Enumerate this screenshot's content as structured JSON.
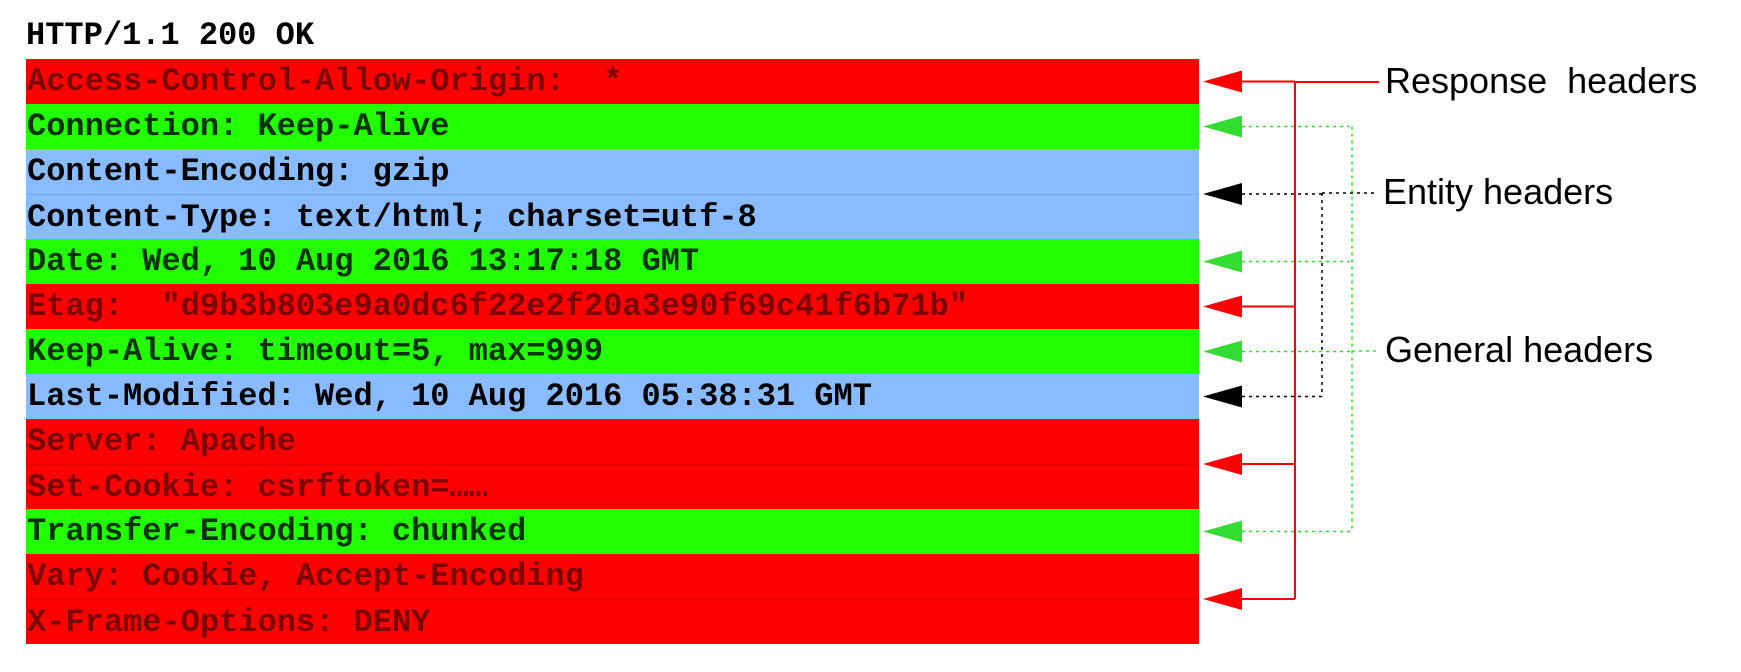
{
  "status_line": "HTTP/1.1 200 OK",
  "colors": {
    "response": "#ff0000",
    "general": "#22ff00",
    "entity": "#88bbff",
    "response_text": "#7a0000",
    "general_text": "#003300",
    "entity_text": "#000000",
    "response_connector": "#ff0000",
    "general_connector": "#33dd33",
    "entity_connector": "#000000"
  },
  "headers": [
    {
      "text": "Access-Control-Allow-Origin:  *",
      "category": "response"
    },
    {
      "text": "Connection: Keep-Alive",
      "category": "general"
    },
    {
      "text": "Content-Encoding: gzip",
      "category": "entity"
    },
    {
      "text": "Content-Type: text/html; charset=utf-8",
      "category": "entity"
    },
    {
      "text": "Date: Wed, 10 Aug 2016 13:17:18 GMT",
      "category": "general"
    },
    {
      "text": "Etag:  \"d9b3b803e9a0dc6f22e2f20a3e90f69c41f6b71b\"",
      "category": "response"
    },
    {
      "text": "Keep-Alive: timeout=5, max=999",
      "category": "general"
    },
    {
      "text": "Last-Modified: Wed, 10 Aug 2016 05:38:31 GMT",
      "category": "entity"
    },
    {
      "text": "Server: Apache",
      "category": "response"
    },
    {
      "text": "Set-Cookie: csrftoken=……",
      "category": "response"
    },
    {
      "text": "Transfer-Encoding: chunked",
      "category": "general"
    },
    {
      "text": "Vary: Cookie, Accept-Encoding",
      "category": "response"
    },
    {
      "text": "X-Frame-Options: DENY",
      "category": "response"
    }
  ],
  "labels": {
    "response": "Response  headers",
    "entity": "Entity headers",
    "general": "General headers"
  }
}
